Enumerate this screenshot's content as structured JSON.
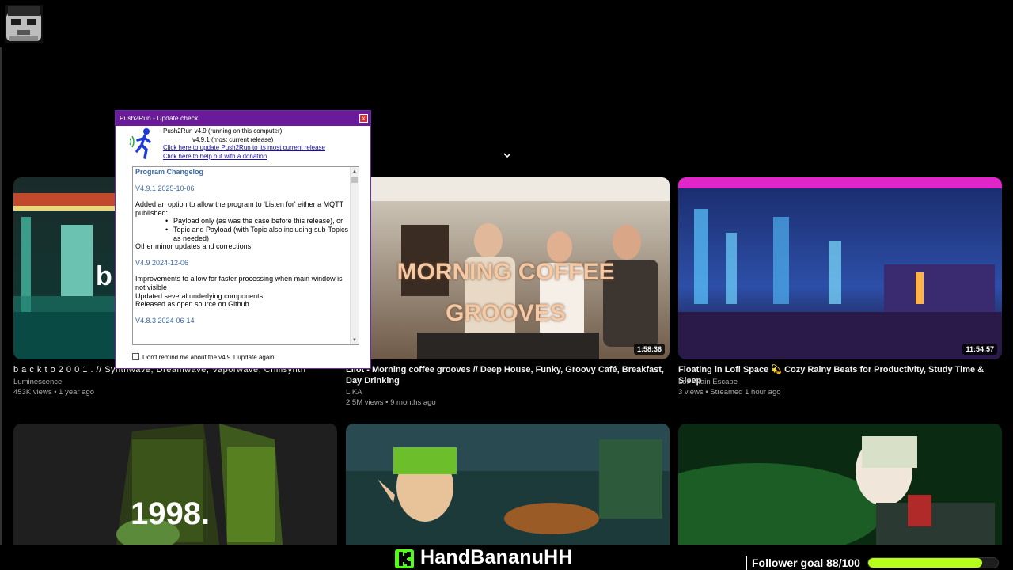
{
  "dialog": {
    "title": "Push2Run - Update check",
    "close_label": "x",
    "running_version": "Push2Run v4.9 (running on this computer)",
    "current_version": "v4.9.1 (most current release)",
    "update_link": "Click here to update Push2Run to its most current release",
    "donate_link": "Click here to help out with a donation",
    "changelog": {
      "heading": "Program Changelog",
      "v1": "V4.9.1 2025-10-06",
      "v1_intro": "Added an option to allow the program to 'Listen for' either a MQTT published:",
      "v1_b1": "Payload only (as was the case before this release), or",
      "v1_b2": "Topic and Payload (with Topic also including sub-Topics as needed)",
      "v1_other": "Other minor updates and corrections",
      "v2": "V4.9 2024-12-06",
      "v2_l1": "Improvements to allow for faster processing when main window is not visible",
      "v2_l2": "Updated several underlying components",
      "v2_l3": "Released as open source on Github",
      "v3": "V4.8.3 2024-06-14"
    },
    "checkbox_label": "Don't remind me about the v4.9.1 update again"
  },
  "videos": [
    {
      "title": "b a c k  t o  2 0 0 1 .  // Synthwave, Dreamwave, Vaporwave, Chillsynth",
      "channel": "Luminescence",
      "stats": "453K views • 1 year ago",
      "overlay": "b"
    },
    {
      "title": "Lilot - Morning coffee grooves // Deep House, Funky, Groovy Café, Breakfast, Day Drinking",
      "channel": "LIKA",
      "stats": "2.5M views • 9 months ago",
      "duration": "1:58:36",
      "overlay": "MORNING COFFEE GROOVES"
    },
    {
      "title": "Floating in Lofi Space 💫 Cozy Rainy Beats for Productivity, Study Time & Sleep",
      "channel": "LoFi Rain Escape",
      "stats": "3 views • Streamed 1 hour ago",
      "duration": "11:54:57"
    }
  ],
  "row2": {
    "overlay": "1998."
  },
  "stream": {
    "channel_name": "HandBananuHH",
    "goal_label": "Follower goal 88/100",
    "goal_fraction": 0.88
  }
}
